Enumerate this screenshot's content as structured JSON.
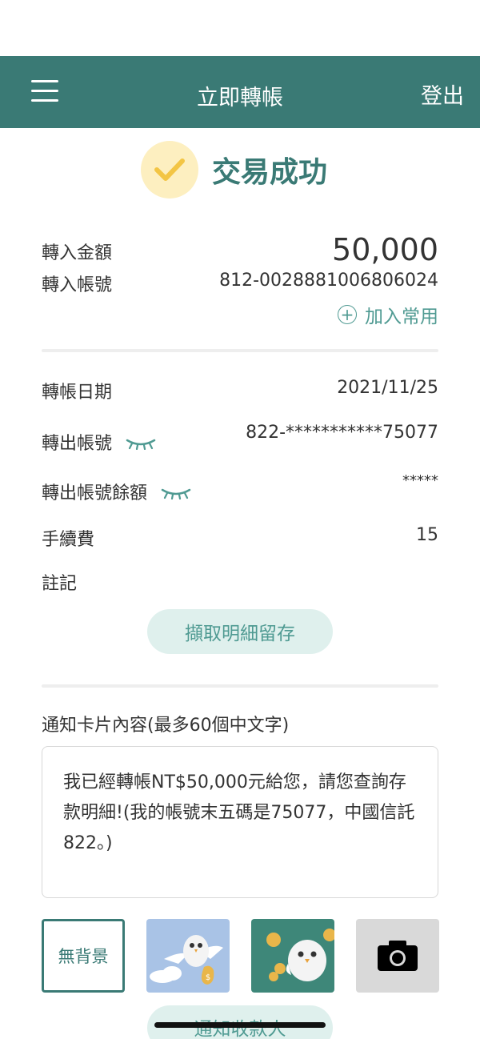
{
  "header": {
    "title": "立即轉帳",
    "logout_label": "登出",
    "menu_icon": "hamburger-menu-icon"
  },
  "result": {
    "status_text": "交易成功",
    "icon": "check-icon"
  },
  "transfer_in": {
    "amount_label": "轉入金額",
    "amount_value": "50,000",
    "account_label": "轉入帳號",
    "account_value": "812-0028881006806024",
    "add_favorite_label": "加入常用"
  },
  "details": {
    "date_label": "轉帳日期",
    "date_value": "2021/11/25",
    "out_account_label": "轉出帳號",
    "out_account_value": "822-***********75077",
    "balance_label": "轉出帳號餘額",
    "balance_value": "*****",
    "fee_label": "手續費",
    "fee_value": "15",
    "note_label": "註記",
    "save_detail_label": "擷取明細留存"
  },
  "notification": {
    "section_title": "通知卡片內容(最多60個中文字)",
    "message": "我已經轉帳NT$50,000元給您，請您查詢存款明細!(我的帳號末五碼是75077，中國信託822。)",
    "backgrounds": {
      "none_label": "無背景",
      "options": [
        "owl-money-bag-sky",
        "owl-coins-green",
        "camera-icon"
      ]
    },
    "notify_button_label": "通知收款人"
  },
  "colors": {
    "brand": "#3a7a75",
    "accent": "#4f9a92",
    "check_bg": "#fdefc0",
    "check": "#f3c544",
    "pill_bg": "#dff0ed"
  }
}
